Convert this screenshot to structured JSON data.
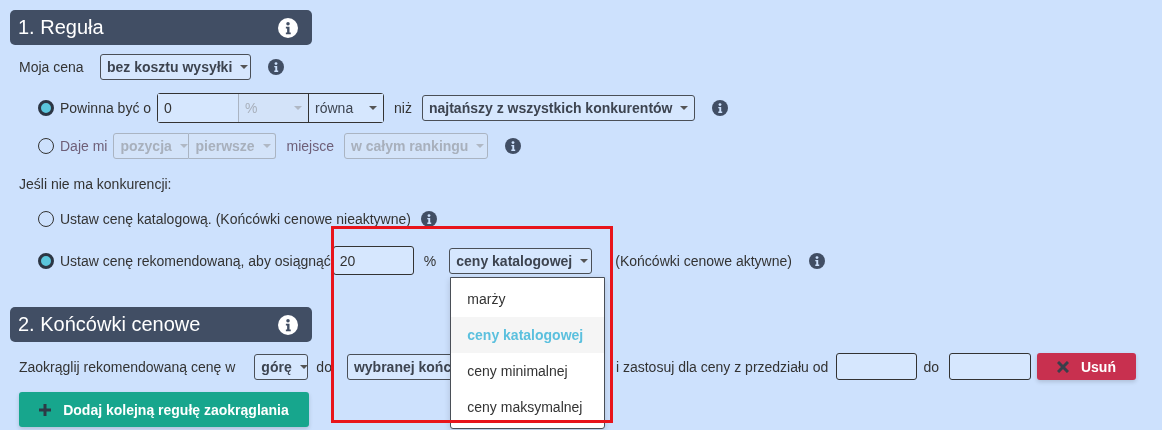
{
  "rule": {
    "title": "1. Reguła",
    "my_price": {
      "label": "Moja cena",
      "value": "bez kosztu wysyłki"
    },
    "options": [
      {
        "kind": "offset",
        "selected": true,
        "disabled": false,
        "label": "Powinna być o",
        "amount": "0",
        "unit": {
          "label": "%",
          "disabled": true
        },
        "relation": {
          "label": "równa",
          "disabled": false
        },
        "than": "niż",
        "target": "najtańszy z wszystkich konkurentów"
      },
      {
        "kind": "position",
        "selected": false,
        "disabled": true,
        "label": "Daje mi",
        "position": "pozycja",
        "place": "pierwsze",
        "word": "miejsce",
        "scope": "w całym rankingu"
      }
    ],
    "no_competition": {
      "label": "Jeśli nie ma konkurencji:",
      "options": [
        {
          "kind": "catalog",
          "selected": false,
          "label": "Ustaw cenę katalogową. (Końcówki cenowe nieaktywne)"
        },
        {
          "kind": "recommended",
          "selected": true,
          "label": "Ustaw cenę rekomendowaną, aby osiągnąć",
          "value": "20",
          "unit": "%",
          "basis": {
            "value": "ceny katalogowej",
            "expanded": true,
            "options": [
              {
                "label": "marży",
                "selected": false
              },
              {
                "label": "ceny katalogowej",
                "selected": true
              },
              {
                "label": "ceny minimalnej",
                "selected": false
              },
              {
                "label": "ceny maksymalnej",
                "selected": false
              }
            ]
          },
          "note": "(Końcówki cenowe aktywne)"
        }
      ]
    }
  },
  "endings": {
    "title": "2. Końcówki cenowe",
    "round_label": "Zaokrąglij rekomendowaną cenę w",
    "direction": "górę",
    "to_label": "do",
    "ending": "wybranej końc",
    "range_label": "i zastosuj dla ceny z przedziału od",
    "range_to_label": "do",
    "delete_button": "Usuń",
    "add_button": "Dodaj kolejną regułę zaokrąglania"
  }
}
